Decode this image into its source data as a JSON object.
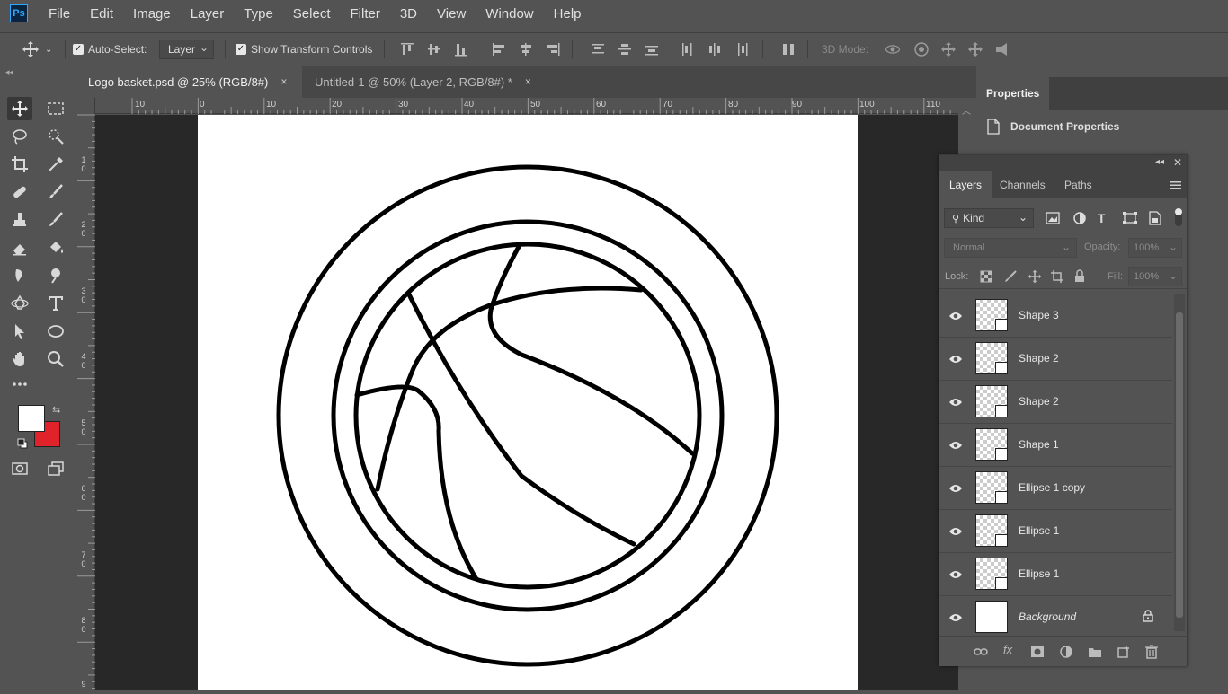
{
  "app": {
    "logo": "Ps"
  },
  "menu": [
    "File",
    "Edit",
    "Image",
    "Layer",
    "Type",
    "Select",
    "Filter",
    "3D",
    "View",
    "Window",
    "Help"
  ],
  "options": {
    "auto_select_label": "Auto-Select:",
    "auto_select_value": "Layer",
    "show_transform_label": "Show Transform Controls",
    "mode_3d_label": "3D Mode:"
  },
  "tabs": [
    {
      "label": "Logo basket.psd @ 25% (RGB/8#)",
      "close": "×",
      "active": true
    },
    {
      "label": "Untitled-1 @ 50% (Layer 2, RGB/8#) *",
      "close": "×",
      "active": false
    }
  ],
  "ruler": {
    "h_labels": [
      "10",
      "0",
      "10",
      "20",
      "30",
      "40",
      "50",
      "60",
      "70",
      "80",
      "90",
      "100",
      "110"
    ],
    "v_labels": [
      "1\n0",
      "2\n0",
      "3\n0",
      "4\n0",
      "5\n0",
      "6\n0",
      "7\n0",
      "8\n0",
      "9"
    ]
  },
  "colors": {
    "foreground": "#ffffff",
    "background": "#e0232a",
    "accent": "#31a8ff"
  },
  "properties": {
    "tab": "Properties",
    "document_properties": "Document Properties"
  },
  "layers_panel": {
    "tabs": [
      "Layers",
      "Channels",
      "Paths"
    ],
    "filter_kind": "Kind",
    "blend_mode": "Normal",
    "opacity_label": "Opacity:",
    "opacity_value": "100%",
    "lock_label": "Lock:",
    "fill_label": "Fill:",
    "fill_value": "100%",
    "layers": [
      {
        "name": "Shape 3",
        "type": "shape",
        "visible": true
      },
      {
        "name": "Shape 2",
        "type": "shape",
        "visible": true
      },
      {
        "name": "Shape 2",
        "type": "shape",
        "visible": true
      },
      {
        "name": "Shape 1",
        "type": "shape",
        "visible": true
      },
      {
        "name": "Ellipse 1 copy",
        "type": "shape",
        "visible": true
      },
      {
        "name": "Ellipse 1",
        "type": "shape",
        "visible": true
      },
      {
        "name": "Ellipse 1",
        "type": "shape",
        "visible": true
      },
      {
        "name": "Background",
        "type": "background",
        "visible": true,
        "locked": true
      }
    ]
  }
}
